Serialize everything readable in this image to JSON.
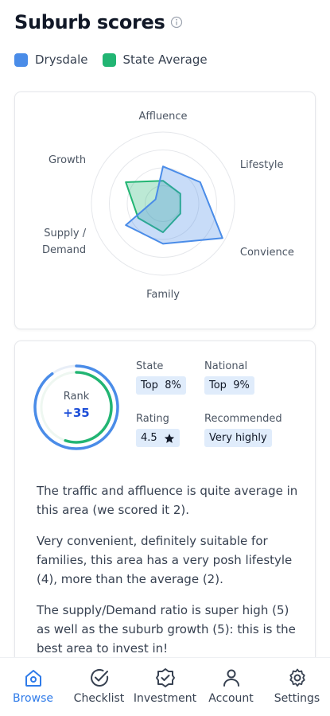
{
  "header": {
    "title": "Suburb scores"
  },
  "legend": [
    {
      "label": "Drysdale",
      "color": "#4a8ce8"
    },
    {
      "label": "State Average",
      "color": "#22b573"
    }
  ],
  "chart_data": {
    "type": "radar",
    "axes": [
      "Affluence",
      "Lifestyle",
      "Convience",
      "Family",
      "Supply / Demand",
      "Growth"
    ],
    "max": 5,
    "rings": 4,
    "series": [
      {
        "name": "Drysdale",
        "values": [
          2.6,
          3.0,
          4.8,
          2.8,
          3.0,
          0.6
        ],
        "color": "#4a8ce8"
      },
      {
        "name": "State Average",
        "values": [
          1.6,
          1.4,
          1.4,
          2.0,
          2.0,
          3.0
        ],
        "color": "#22b573"
      }
    ]
  },
  "rank": {
    "label": "Rank",
    "value": "+35",
    "progress_blue": 0.9,
    "progress_green": 0.55
  },
  "stats": {
    "state": {
      "label": "State",
      "value": "Top  8%"
    },
    "national": {
      "label": "National",
      "value": "Top  9%"
    },
    "rating": {
      "label": "Rating",
      "value": "4.5",
      "icon": "star-icon"
    },
    "recommended": {
      "label": "Recommended",
      "value": "Very highly"
    }
  },
  "description": [
    "The traffic and affluence is quite average in this area (we scored it 2).",
    "Very convenient, definitely suitable for families, this area has a very posh lifestyle (4), more than the average (2).",
    "The supply/Demand ratio is super high (5) as well as the suburb growth (5): this is the best area to invest in!"
  ],
  "nav": [
    {
      "label": "Browse",
      "icon": "home-icon",
      "active": true
    },
    {
      "label": "Checklist",
      "icon": "check-circle-icon",
      "active": false
    },
    {
      "label": "Investment",
      "icon": "badge-check-icon",
      "active": false
    },
    {
      "label": "Account",
      "icon": "user-icon",
      "active": false
    },
    {
      "label": "Settings",
      "icon": "gear-icon",
      "active": false
    }
  ],
  "colors": {
    "accent": "#2f7be9",
    "blue": "#4a8ce8",
    "green": "#22b573"
  }
}
